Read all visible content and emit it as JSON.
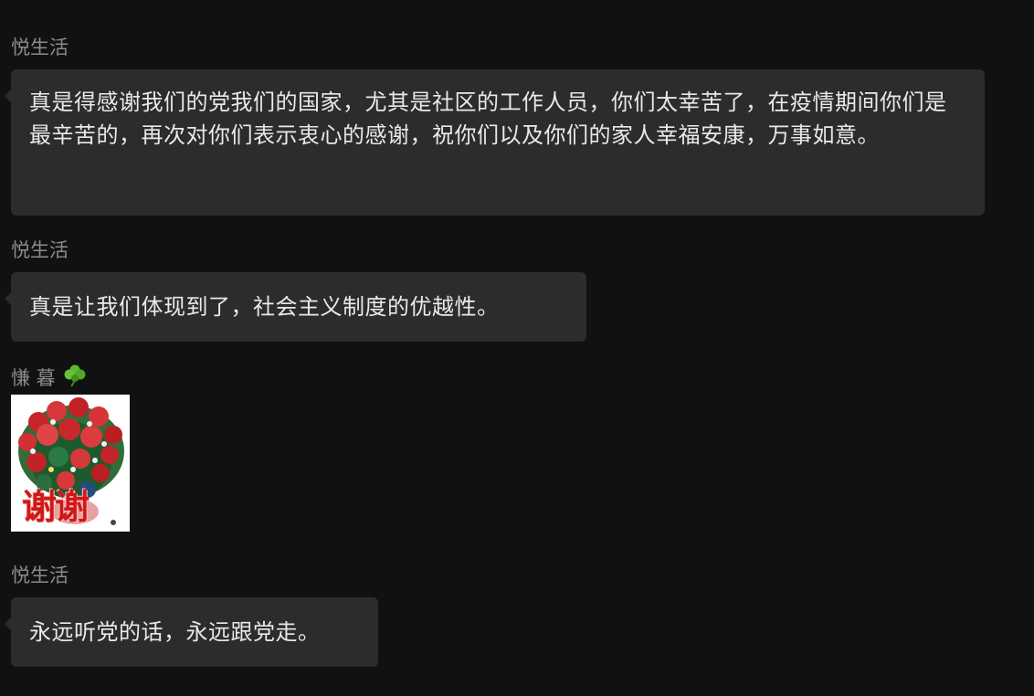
{
  "messages": [
    {
      "sender": "悦生活",
      "text": "真是得感谢我们的党我们的国家，尤其是社区的工作人员，你们太幸苦了，在疫情期间你们是最辛苦的，再次对你们表示衷心的感谢，祝你们以及你们的家人幸福安康，万事如意。"
    },
    {
      "sender": "悦生活",
      "text": "真是让我们体现到了，社会主义制度的优越性。"
    },
    {
      "sender": "慊 暮",
      "sender_icon": "four-leaf-clover-icon",
      "sticker": {
        "icon": "flower-bouquet-sticker",
        "caption": "谢谢"
      }
    },
    {
      "sender": "悦生活",
      "text": "永远听党的话，永远跟党走。"
    }
  ],
  "colors": {
    "background": "#111111",
    "bubble": "#2c2c2c",
    "sender_name": "#8b8b8b",
    "message_text": "#e9e9e9",
    "sticker_caption": "#d01818",
    "clover": "#5cb82e"
  }
}
